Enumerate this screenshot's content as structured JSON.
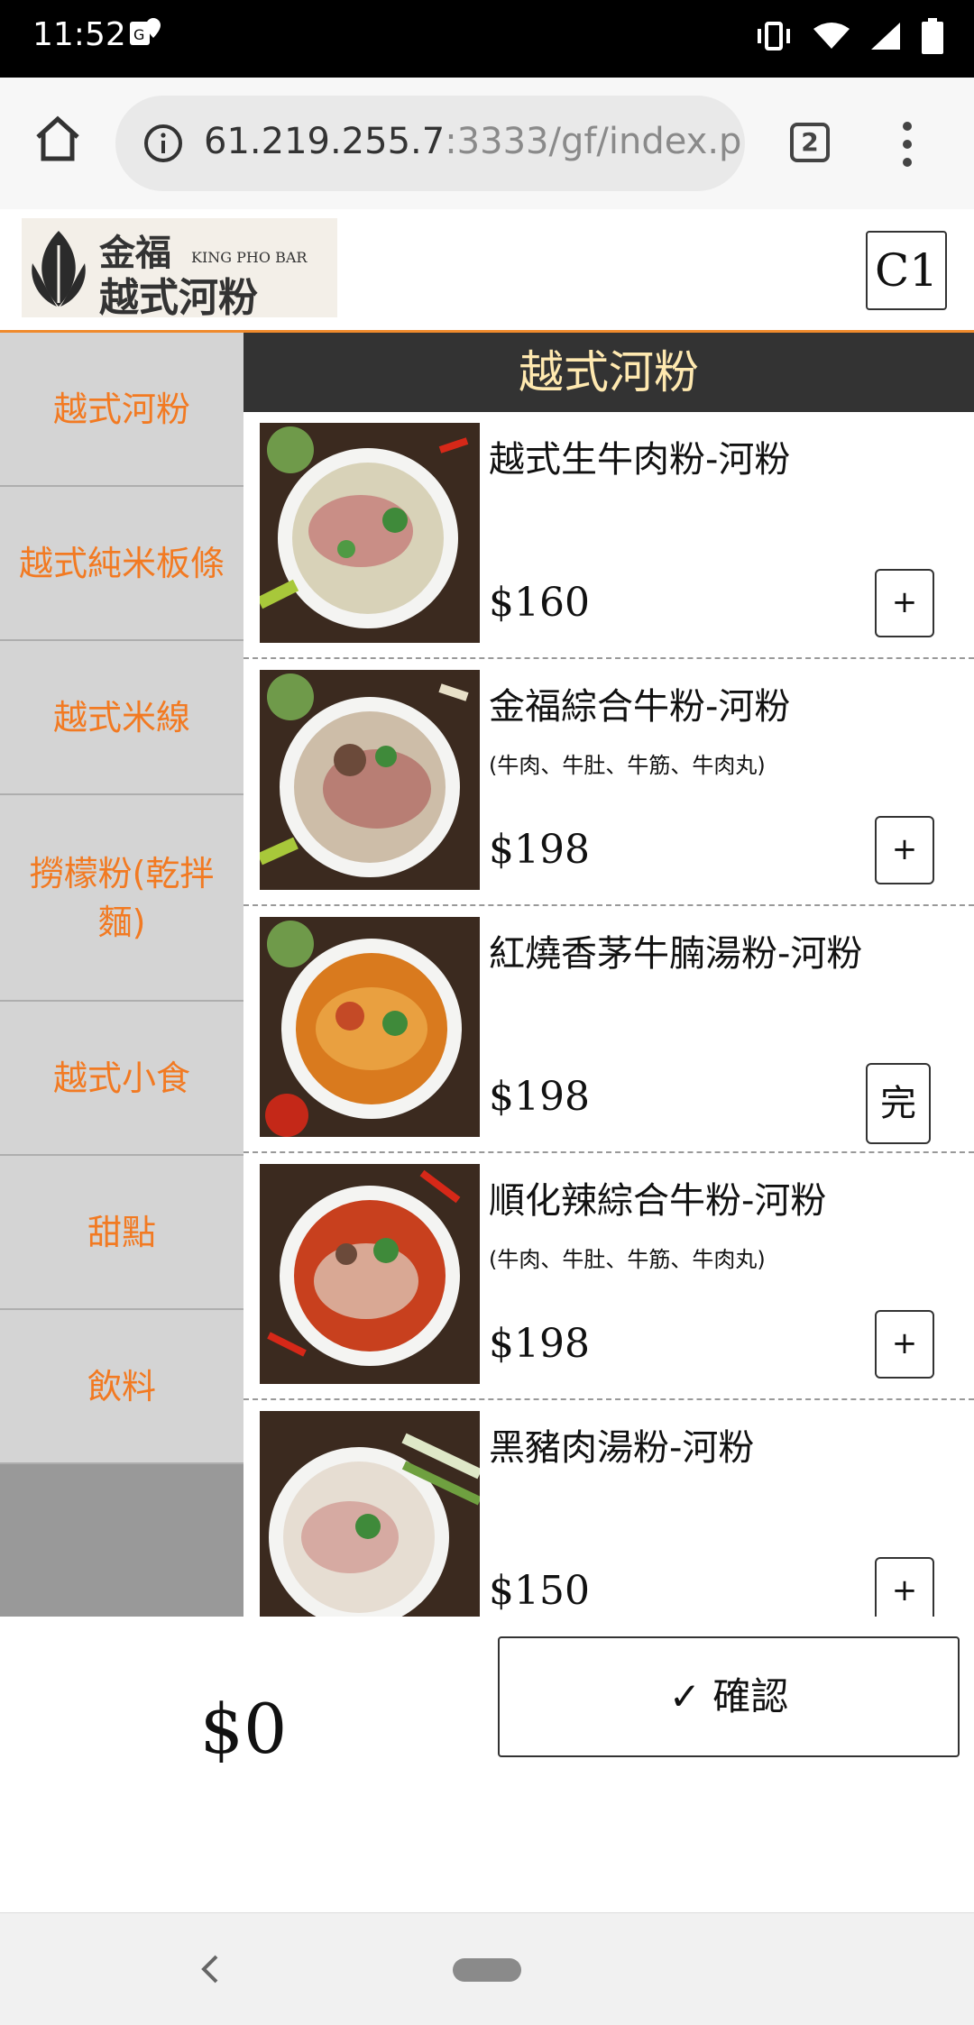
{
  "status_bar": {
    "time": "11:52"
  },
  "browser": {
    "url_host": "61.219.255.7",
    "url_rest": ":3333/gf/index.ph",
    "tab_count": "2"
  },
  "header": {
    "logo_cn_line1": "金福",
    "logo_en": "KING PHO BAR",
    "logo_cn_line2": "越式河粉",
    "table_code": "C1"
  },
  "sidebar": {
    "items": [
      {
        "label": "越式河粉"
      },
      {
        "label": "越式純米板條"
      },
      {
        "label": "越式米線"
      },
      {
        "label": "撈檬粉(乾拌麵)"
      },
      {
        "label": "越式小食"
      },
      {
        "label": "甜點"
      },
      {
        "label": "飲料"
      }
    ]
  },
  "main": {
    "category_title": "越式河粉",
    "items": [
      {
        "name": "越式生牛肉粉-河粉",
        "desc": "",
        "price": "$160",
        "button": "+"
      },
      {
        "name": "金福綜合牛粉-河粉",
        "desc": "(牛肉、牛肚、牛筋、牛肉丸)",
        "price": "$198",
        "button": "+"
      },
      {
        "name": "紅燒香茅牛腩湯粉-河粉",
        "desc": "",
        "price": "$198",
        "button": "完"
      },
      {
        "name": "順化辣綜合牛粉-河粉",
        "desc": "(牛肉、牛肚、牛筋、牛肉丸)",
        "price": "$198",
        "button": "+"
      },
      {
        "name": "黑豬肉湯粉-河粉",
        "desc": "",
        "price": "$150",
        "button": "+"
      }
    ]
  },
  "footer": {
    "total": "$0",
    "confirm_label": "✓ 確認"
  },
  "colors": {
    "accent": "#f27a22",
    "header_bg": "#333333",
    "header_text": "#ffe9b0",
    "sidebar_bg": "#d4d4d4"
  }
}
